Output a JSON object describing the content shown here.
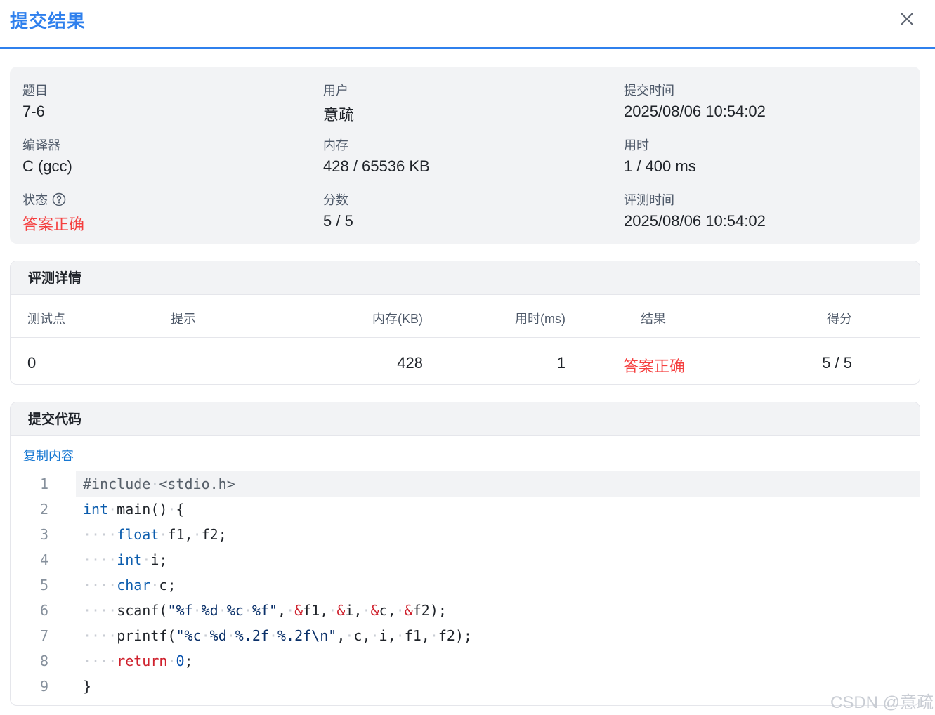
{
  "header": {
    "title": "提交结果"
  },
  "info": {
    "problem_label": "题目",
    "problem_value": "7-6",
    "user_label": "用户",
    "user_value": "意疏",
    "submit_time_label": "提交时间",
    "submit_time_value": "2025/08/06 10:54:02",
    "compiler_label": "编译器",
    "compiler_value": "C (gcc)",
    "memory_label": "内存",
    "memory_value": "428 / 65536 KB",
    "time_label": "用时",
    "time_value": "1 / 400 ms",
    "status_label": "状态",
    "status_value": "答案正确",
    "score_label": "分数",
    "score_value": "5 / 5",
    "judge_time_label": "评测时间",
    "judge_time_value": "2025/08/06 10:54:02"
  },
  "detail": {
    "title": "评测详情",
    "columns": [
      "测试点",
      "提示",
      "内存(KB)",
      "用时(ms)",
      "结果",
      "得分"
    ],
    "rows": [
      {
        "case": "0",
        "hint": "",
        "memory": "428",
        "time": "1",
        "result": "答案正确",
        "score": "5 / 5"
      }
    ]
  },
  "code": {
    "title": "提交代码",
    "copy_label": "复制内容",
    "line_numbers": [
      "1",
      "2",
      "3",
      "4",
      "5",
      "6",
      "7",
      "8",
      "9"
    ],
    "lines": [
      "#include <stdio.h>",
      "int main() {",
      "    float f1, f2;",
      "    int i;",
      "    char c;",
      "    scanf(\"%f %d %c %f\", &f1, &i, &c, &f2);",
      "    printf(\"%c %d %.2f %.2f\\n\", c, i, f1, f2);",
      "    return 0;",
      "}"
    ]
  },
  "watermark": "CSDN @意疏",
  "colors": {
    "accent": "#2f80ed",
    "success_red": "#f53f3f",
    "link": "#1677d2"
  }
}
